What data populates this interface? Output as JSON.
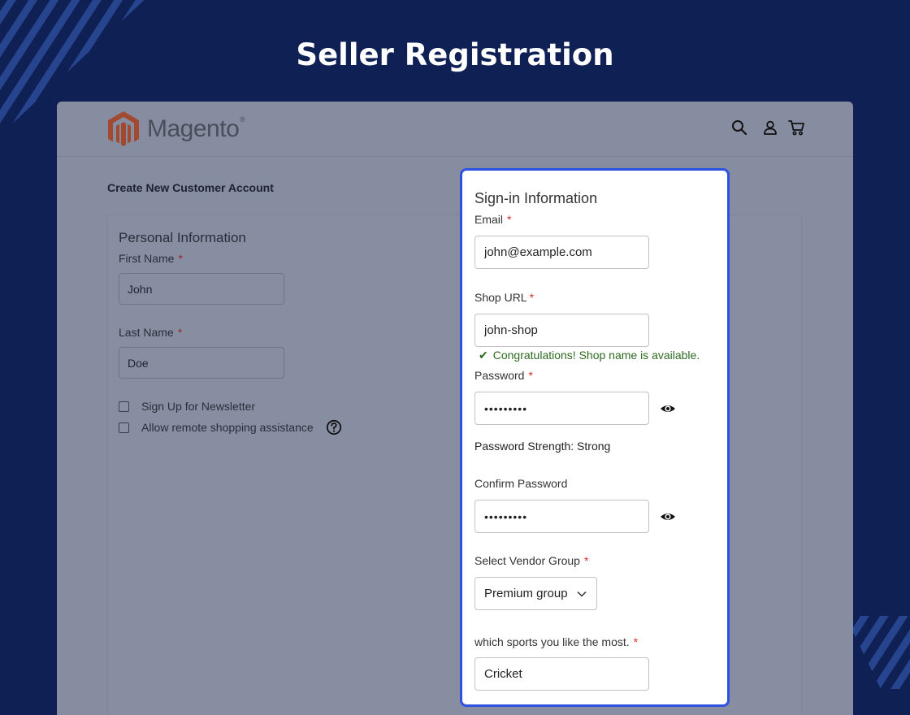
{
  "page": {
    "heading": "Seller Registration"
  },
  "header": {
    "logo_text": "Magento",
    "logo_mark": "®",
    "icons": [
      "search-icon",
      "user-icon",
      "cart-icon"
    ]
  },
  "account": {
    "title": "Create New Customer Account"
  },
  "personal": {
    "title": "Personal Information",
    "first_name_label": "First Name",
    "first_name_value": "John",
    "last_name_label": "Last Name",
    "last_name_value": "Doe",
    "newsletter_label": "Sign Up for Newsletter",
    "remote_label": "Allow remote shopping assistance",
    "required_mark": "*"
  },
  "signin": {
    "title": "Sign-in Information",
    "email_label": "Email",
    "email_value": "john@example.com",
    "shop_url_label": "Shop URL",
    "shop_url_value": "john-shop",
    "shop_available_tick": "✔",
    "shop_available_msg": "Congratulations! Shop name is available.",
    "password_label": "Password",
    "password_value": "•••••••••",
    "password_strength": "Password Strength: Strong",
    "confirm_label": "Confirm Password",
    "confirm_value": "•••••••••",
    "vendor_group_label": "Select Vendor Group",
    "vendor_group_value": "Premium group",
    "sports_label": "which sports you like the most.",
    "sports_value": "Cricket",
    "required_mark": "*"
  },
  "colors": {
    "background": "#0f2054",
    "accent_border": "#2d52e0",
    "success": "#2d6a1f",
    "required": "#e02b27"
  }
}
